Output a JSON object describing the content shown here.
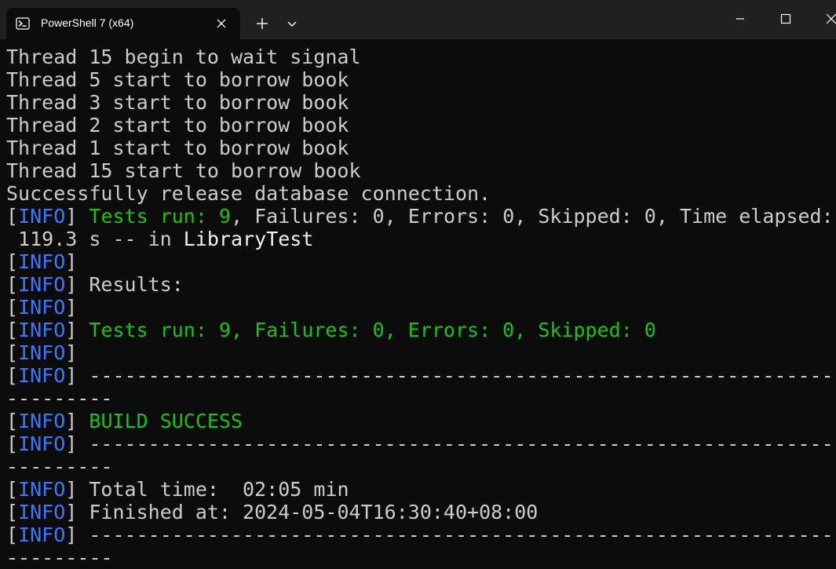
{
  "window": {
    "tab_title": "PowerShell 7 (x64)",
    "tab_icon": "powershell-icon",
    "new_tab_icon": "plus-icon",
    "dropdown_icon": "chevron-down-icon",
    "minimize_icon": "minimize-icon",
    "maximize_icon": "maximize-icon",
    "close_icon": "close-icon",
    "colors": {
      "titlebar_bg": "#202020",
      "terminal_bg": "#0c0c0c",
      "text_default": "#cccccc",
      "text_info": "#3b78ff",
      "text_success": "#16c60c",
      "text_bright": "#f2f2f2"
    }
  },
  "terminal": {
    "lines": [
      [
        {
          "t": "Thread 15 begin to wait signal",
          "c": "gray"
        }
      ],
      [
        {
          "t": "Thread 5 start to borrow book",
          "c": "gray"
        }
      ],
      [
        {
          "t": "Thread 3 start to borrow book",
          "c": "gray"
        }
      ],
      [
        {
          "t": "Thread 2 start to borrow book",
          "c": "gray"
        }
      ],
      [
        {
          "t": "Thread 1 start to borrow book",
          "c": "gray"
        }
      ],
      [
        {
          "t": "Thread 15 start to borrow book",
          "c": "gray"
        }
      ],
      [
        {
          "t": "Successfully release database connection.",
          "c": "gray"
        }
      ],
      [
        {
          "t": "[",
          "c": "gray"
        },
        {
          "t": "INFO",
          "c": "blue"
        },
        {
          "t": "] ",
          "c": "gray"
        },
        {
          "t": "Tests run: 9",
          "c": "green"
        },
        {
          "t": ", Failures: 0, Errors: 0, Skipped: 0, Time elapsed:",
          "c": "gray"
        }
      ],
      [
        {
          "t": " 119.3 s -- in ",
          "c": "gray"
        },
        {
          "t": "LibraryTest",
          "c": "white"
        }
      ],
      [
        {
          "t": "[",
          "c": "gray"
        },
        {
          "t": "INFO",
          "c": "blue"
        },
        {
          "t": "]",
          "c": "gray"
        }
      ],
      [
        {
          "t": "[",
          "c": "gray"
        },
        {
          "t": "INFO",
          "c": "blue"
        },
        {
          "t": "] Results:",
          "c": "gray"
        }
      ],
      [
        {
          "t": "[",
          "c": "gray"
        },
        {
          "t": "INFO",
          "c": "blue"
        },
        {
          "t": "]",
          "c": "gray"
        }
      ],
      [
        {
          "t": "[",
          "c": "gray"
        },
        {
          "t": "INFO",
          "c": "blue"
        },
        {
          "t": "] ",
          "c": "gray"
        },
        {
          "t": "Tests run: 9, Failures: 0, Errors: 0, Skipped: 0",
          "c": "green"
        }
      ],
      [
        {
          "t": "[",
          "c": "gray"
        },
        {
          "t": "INFO",
          "c": "blue"
        },
        {
          "t": "]",
          "c": "gray"
        }
      ],
      [
        {
          "t": "[",
          "c": "gray"
        },
        {
          "t": "INFO",
          "c": "blue"
        },
        {
          "t": "] ------------------------------------------------------------------------",
          "c": "gray"
        }
      ],
      [
        {
          "t": "---------",
          "c": "gray"
        }
      ],
      [
        {
          "t": "[",
          "c": "gray"
        },
        {
          "t": "INFO",
          "c": "blue"
        },
        {
          "t": "] ",
          "c": "gray"
        },
        {
          "t": "BUILD SUCCESS",
          "c": "green"
        }
      ],
      [
        {
          "t": "[",
          "c": "gray"
        },
        {
          "t": "INFO",
          "c": "blue"
        },
        {
          "t": "] ------------------------------------------------------------------------",
          "c": "gray"
        }
      ],
      [
        {
          "t": "---------",
          "c": "gray"
        }
      ],
      [
        {
          "t": "[",
          "c": "gray"
        },
        {
          "t": "INFO",
          "c": "blue"
        },
        {
          "t": "] Total time:  02:05 min",
          "c": "gray"
        }
      ],
      [
        {
          "t": "[",
          "c": "gray"
        },
        {
          "t": "INFO",
          "c": "blue"
        },
        {
          "t": "] Finished at: 2024-05-04T16:30:40+08:00",
          "c": "gray"
        }
      ],
      [
        {
          "t": "[",
          "c": "gray"
        },
        {
          "t": "INFO",
          "c": "blue"
        },
        {
          "t": "] ------------------------------------------------------------------------",
          "c": "gray"
        }
      ],
      [
        {
          "t": "---------",
          "c": "gray"
        }
      ]
    ]
  }
}
